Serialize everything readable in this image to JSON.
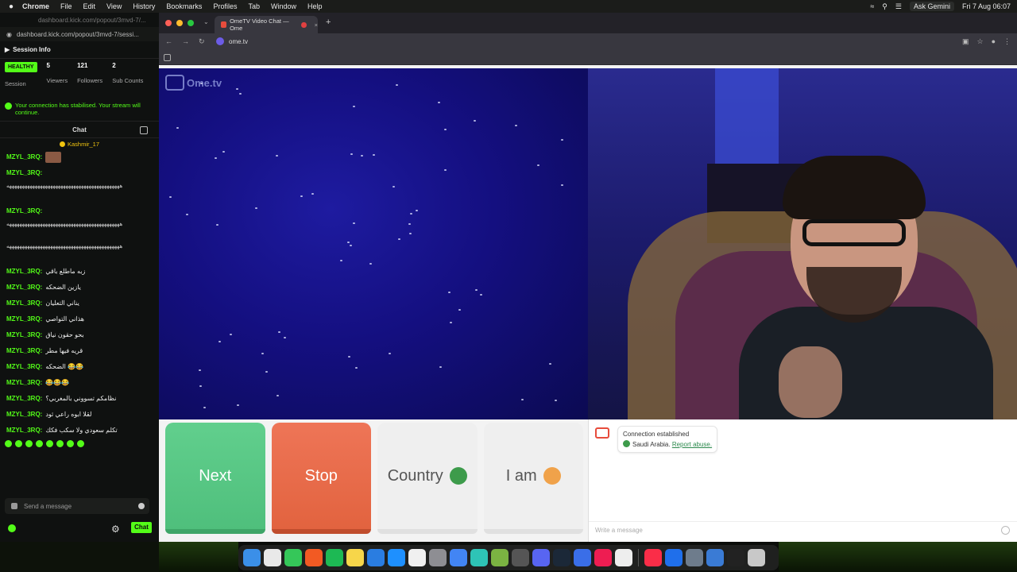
{
  "menubar": {
    "app": "Chrome",
    "items": [
      "File",
      "Edit",
      "View",
      "History",
      "Bookmarks",
      "Profiles",
      "Tab",
      "Window",
      "Help"
    ],
    "gemini": "Ask Gemini",
    "datetime": "Fri 7 Aug  06:07"
  },
  "kick": {
    "url_faded": "dashboard.kick.com/popout/3mvd-7/...",
    "url": "dashboard.kick.com/popout/3mvd-7/sessi...",
    "session_title": "Session Info",
    "stats": [
      {
        "value": "HEALTHY",
        "label": "Session"
      },
      {
        "value": "5",
        "label": "Viewers"
      },
      {
        "value": "121",
        "label": "Followers"
      },
      {
        "value": "2",
        "label": "Sub Counts"
      }
    ],
    "notice": "Your connection has stabilised. Your stream will continue.",
    "chat_title": "Chat",
    "pinned_user": "Kashmir_17",
    "messages": [
      {
        "user": "MZYL_3RQ:",
        "text": ""
      },
      {
        "user": "MZYL_3RQ:",
        "text": "ههههههههههههههههههههههههههههههههههههههههههههه"
      },
      {
        "user": "MZYL_3RQ:",
        "text": "ههههههههههههههههههههههههههههههههههههههههههههه"
      },
      {
        "user": "MZYL_3RQ:",
        "text": "ههههههههههههههههههههههههههههههههههههههههههههه"
      },
      {
        "user": "MZYL_3RQ:",
        "text": "زبه ماطلع باقي"
      },
      {
        "user": "MZYL_3RQ:",
        "text": "يازين الضحكه"
      },
      {
        "user": "MZYL_3RQ:",
        "text": "يناني التعليان"
      },
      {
        "user": "MZYL_3RQ:",
        "text": "هذاني التواصي"
      },
      {
        "user": "MZYL_3RQ:",
        "text": "بحو حقون نياق"
      },
      {
        "user": "MZYL_3RQ:",
        "text": "قريه فيها مطر"
      },
      {
        "user": "MZYL_3RQ:",
        "text": "الضحكه 😂😂"
      },
      {
        "user": "MZYL_3RQ:",
        "text": "😂😂😂"
      },
      {
        "user": "MZYL_3RQ:",
        "text": "نظامكم تسووني بالمغربي؟"
      },
      {
        "user": "MZYL_3RQ:",
        "text": "لقلا ابوه راعي ثود"
      },
      {
        "user": "MZYL_3RQ:",
        "text": "تكلم سعودي ولا سكب فكك"
      }
    ],
    "send_placeholder": "Send a message",
    "chat_button": "Chat"
  },
  "chrome": {
    "tab_title": "OmeTV Video Chat — Ome",
    "address": "ome.tv"
  },
  "ome": {
    "logo": "Ome.tv",
    "buttons": {
      "next": "Next",
      "stop": "Stop",
      "country": "Country",
      "iam": "I am"
    },
    "connection_title": "Connection established",
    "connection_country": "Saudi Arabia.",
    "report_link": "Report abuse.",
    "write_placeholder": "Write a message"
  },
  "colors": {
    "kick_green": "#53fc18",
    "next_green": "#58c785",
    "stop_red": "#e8694a"
  }
}
